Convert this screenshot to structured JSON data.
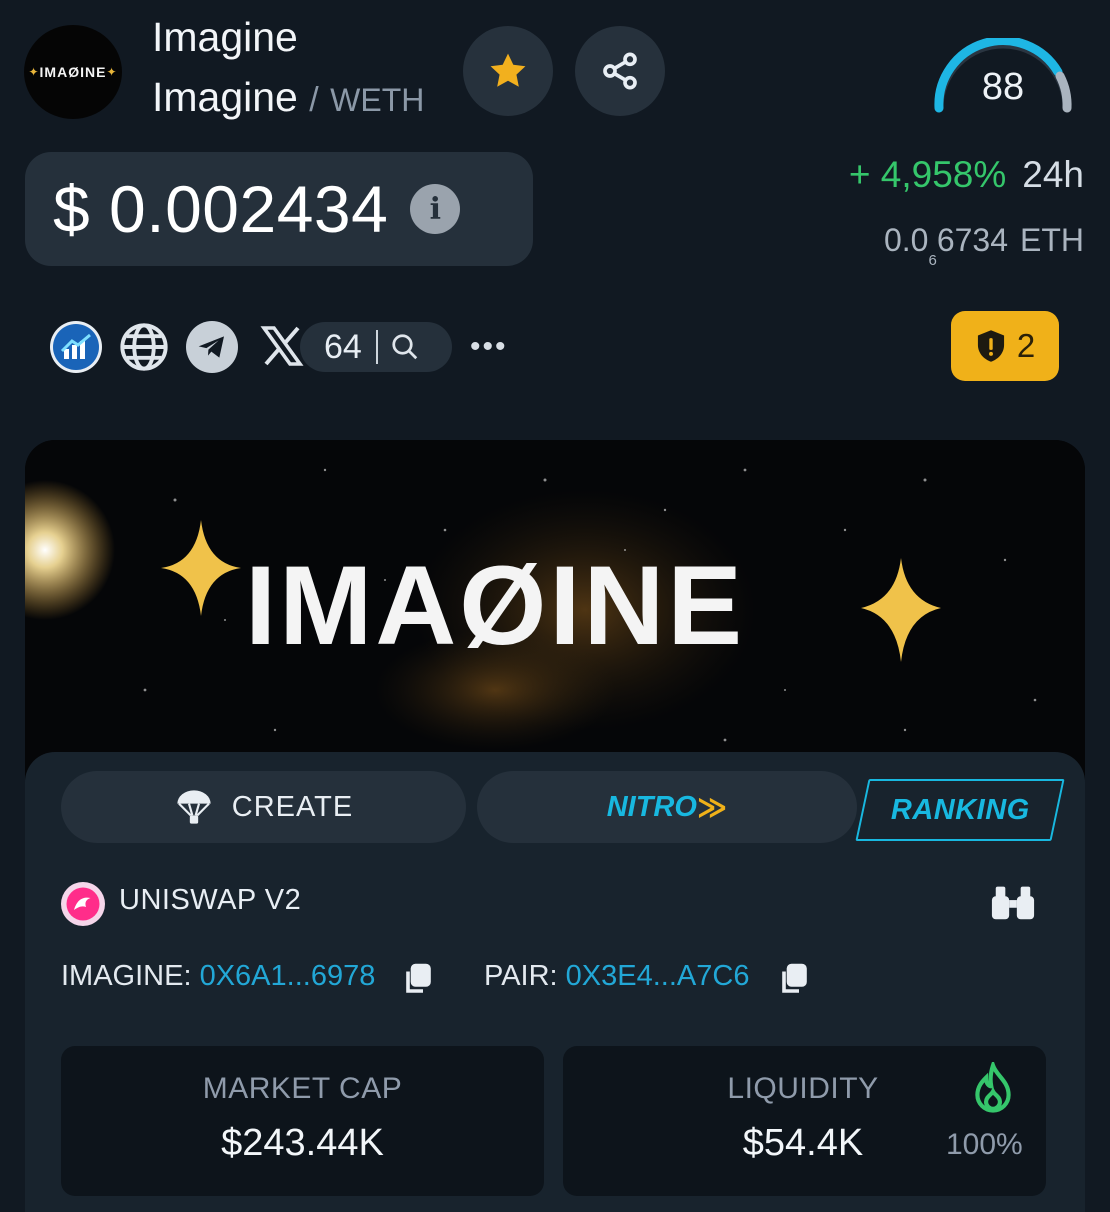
{
  "header": {
    "logo_text": "IMAØINE",
    "token_name": "Imagine",
    "pair_base": "Imagine",
    "pair_separator": "/",
    "pair_quote": "WETH",
    "score": "88"
  },
  "price": {
    "usd": "$ 0.002434",
    "change_pct": "+ 4,958%",
    "change_period": "24h",
    "eth_lead": "0.0",
    "eth_zeros": "6",
    "eth_tail": "6734",
    "eth_unit": "ETH"
  },
  "social": {
    "x_followers": "64",
    "more_label": "•••",
    "warnings_count": "2"
  },
  "banner": {
    "title": "IMAØINE"
  },
  "tabs": {
    "create_label": "CREATE",
    "nitro_label": "NITRO",
    "ranking_label": "RANKING"
  },
  "dex": {
    "name": "UNISWAP V2"
  },
  "addresses": {
    "token_key": "IMAGINE:",
    "token_value": "0X6A1...6978",
    "pair_key": "PAIR:",
    "pair_value": "0X3E4...A7C6"
  },
  "stats": {
    "market_cap_label": "MARKET CAP",
    "market_cap_value": "$243.44K",
    "liquidity_label": "LIQUIDITY",
    "liquidity_value": "$54.4K",
    "liquidity_locked_pct": "100%"
  },
  "colors": {
    "accent_green": "#35c66b",
    "accent_cyan": "#18b8e0",
    "warning_yellow": "#f0b119",
    "star_gold": "#f2b01e"
  }
}
